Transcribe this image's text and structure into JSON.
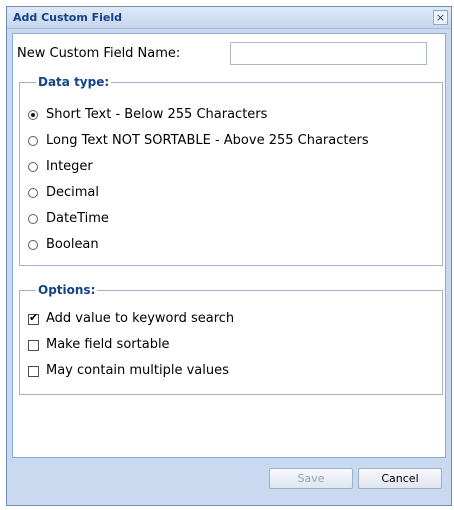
{
  "dialog": {
    "title": "Add Custom Field",
    "close_glyph": "×"
  },
  "name_field": {
    "label": "New Custom Field Name:",
    "value": ""
  },
  "data_type": {
    "legend": "Data type:",
    "options": [
      {
        "label": "Short Text - Below 255 Characters",
        "selected": true
      },
      {
        "label": "Long Text NOT SORTABLE - Above 255 Characters",
        "selected": false
      },
      {
        "label": "Integer",
        "selected": false
      },
      {
        "label": "Decimal",
        "selected": false
      },
      {
        "label": "DateTime",
        "selected": false
      },
      {
        "label": "Boolean",
        "selected": false
      }
    ]
  },
  "options": {
    "legend": "Options:",
    "items": [
      {
        "label": "Add value to keyword search",
        "checked": true
      },
      {
        "label": "Make field sortable",
        "checked": false
      },
      {
        "label": "May contain multiple values",
        "checked": false
      }
    ]
  },
  "buttons": {
    "save": "Save",
    "cancel": "Cancel"
  }
}
